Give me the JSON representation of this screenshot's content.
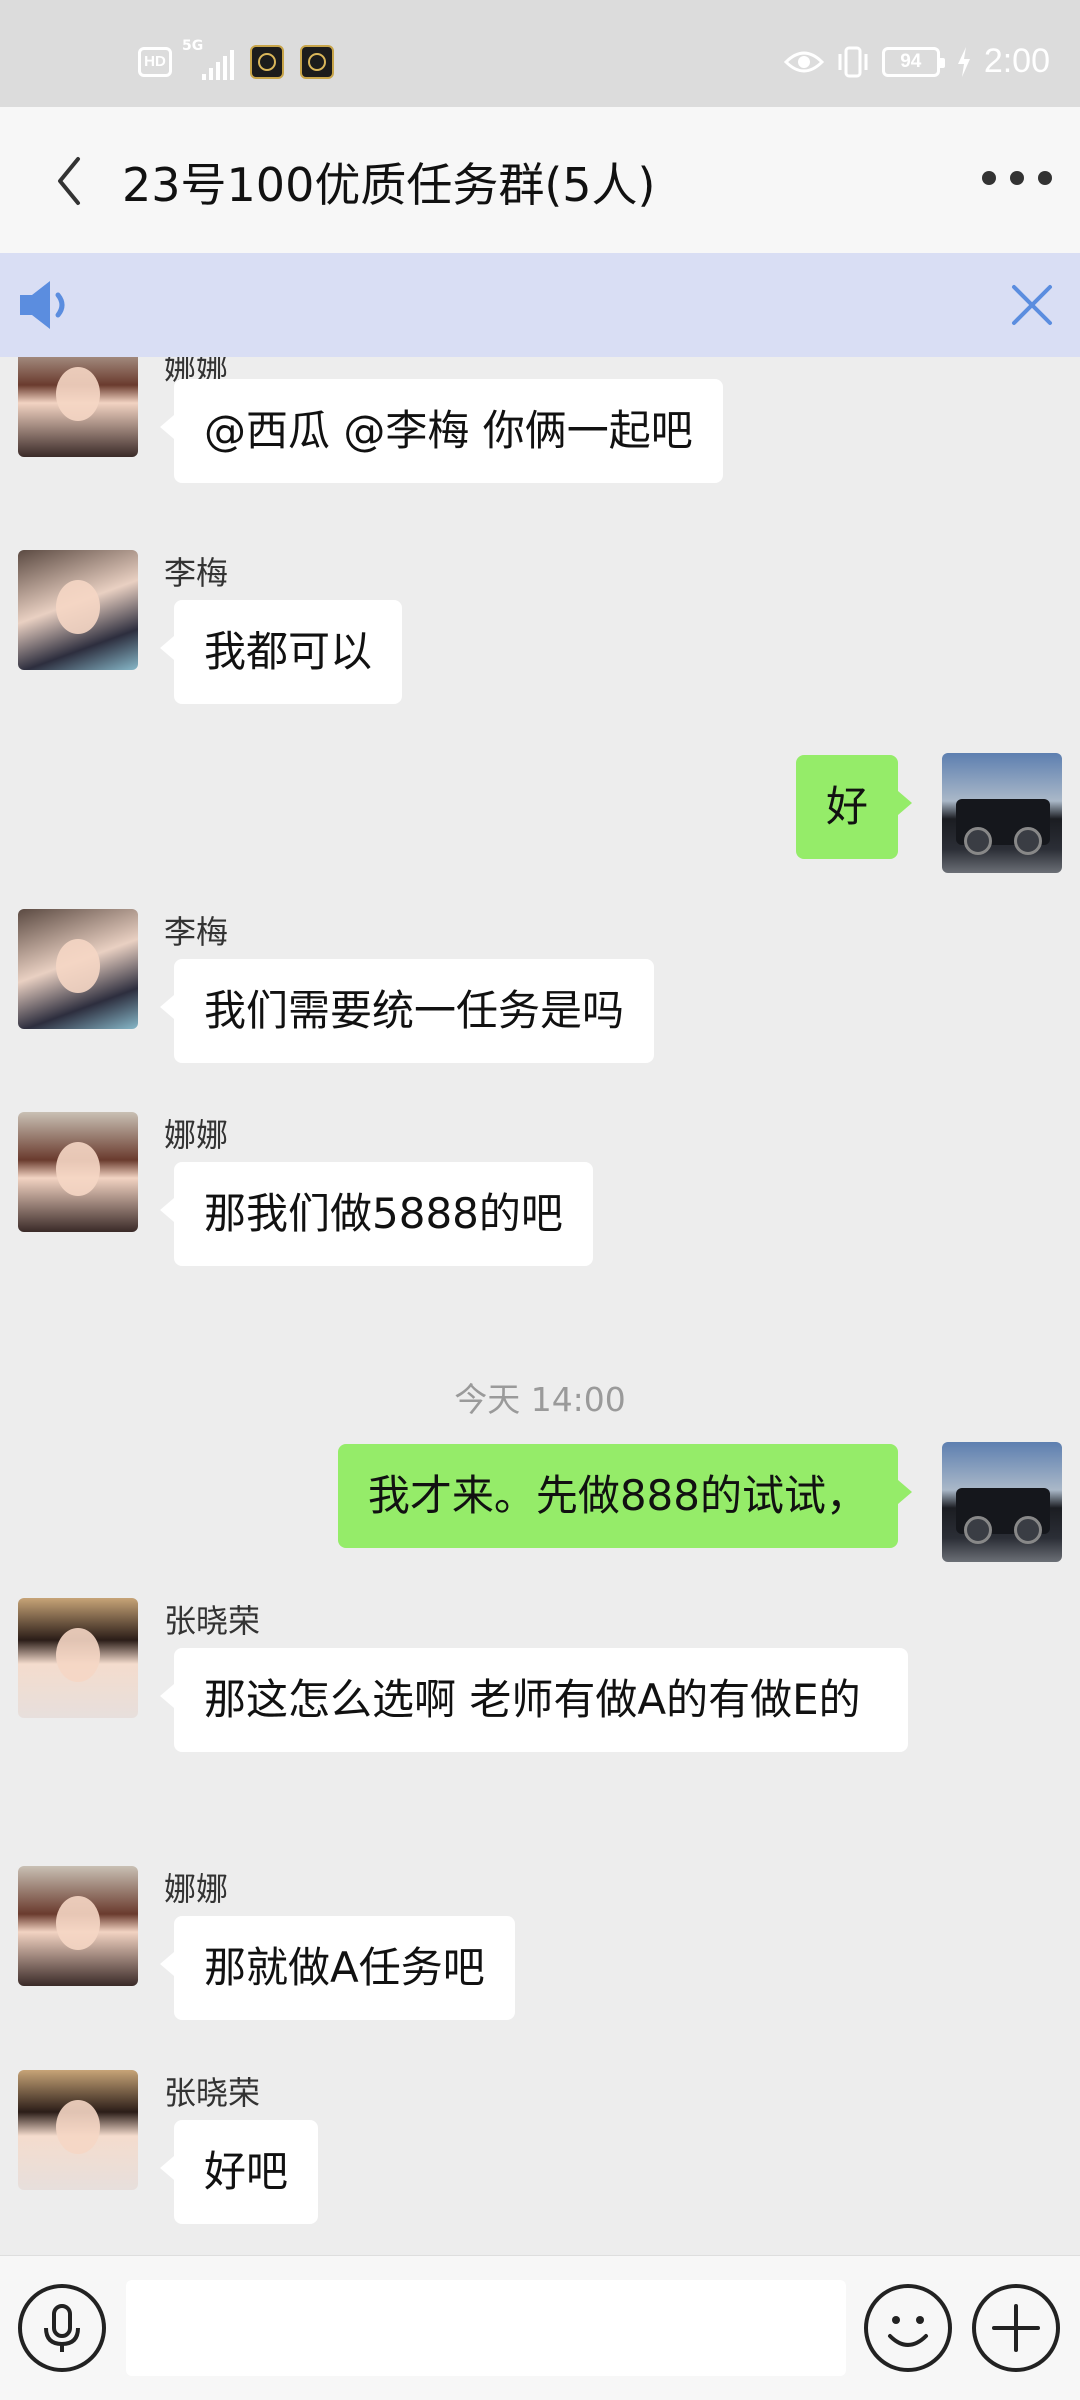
{
  "status_bar": {
    "hd": "HD",
    "network": "5G",
    "battery": "94",
    "time": "2:00"
  },
  "header": {
    "title": "23号100优质任务群(5人)"
  },
  "messages": [
    {
      "sender": "娜娜",
      "text": "@西瓜 @李梅 你俩一起吧"
    },
    {
      "sender": "李梅",
      "text": "我都可以"
    },
    {
      "sender": "",
      "text": "好"
    },
    {
      "sender": "李梅",
      "text": "我们需要统一任务是吗"
    },
    {
      "sender": "娜娜",
      "text": "那我们做5888的吧"
    },
    {
      "sender": "",
      "text": "我才来。先做888的试试，"
    },
    {
      "sender": "张晓荣",
      "text": "那这怎么选啊 老师有做A的有做E的"
    },
    {
      "sender": "娜娜",
      "text": "那就做A任务吧"
    },
    {
      "sender": "张晓荣",
      "text": "好吧"
    }
  ],
  "time_divider": "今天 14:00",
  "colors": {
    "self_bubble": "#95ec69",
    "other_bubble": "#ffffff",
    "banner_bg": "#d9def4",
    "banner_icon": "#5b8ddf",
    "chat_bg": "#ededed"
  },
  "icons": [
    "back-arrow-icon",
    "more-dots-icon",
    "speaker-icon",
    "close-icon",
    "voice-icon",
    "emoji-icon",
    "plus-icon"
  ]
}
